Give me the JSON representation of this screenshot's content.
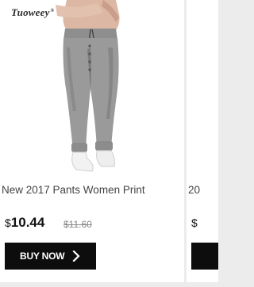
{
  "product": {
    "brand": "Tuoweey",
    "title": "New 2017 Pants Women Print",
    "currency_symbol": "$",
    "price": "10.44",
    "old_price": "$11.60",
    "buy_label": "BUY NOW",
    "buy_icon": "chevron-right-icon"
  },
  "next_product": {
    "title_fragment": "20",
    "currency_symbol": "$"
  }
}
